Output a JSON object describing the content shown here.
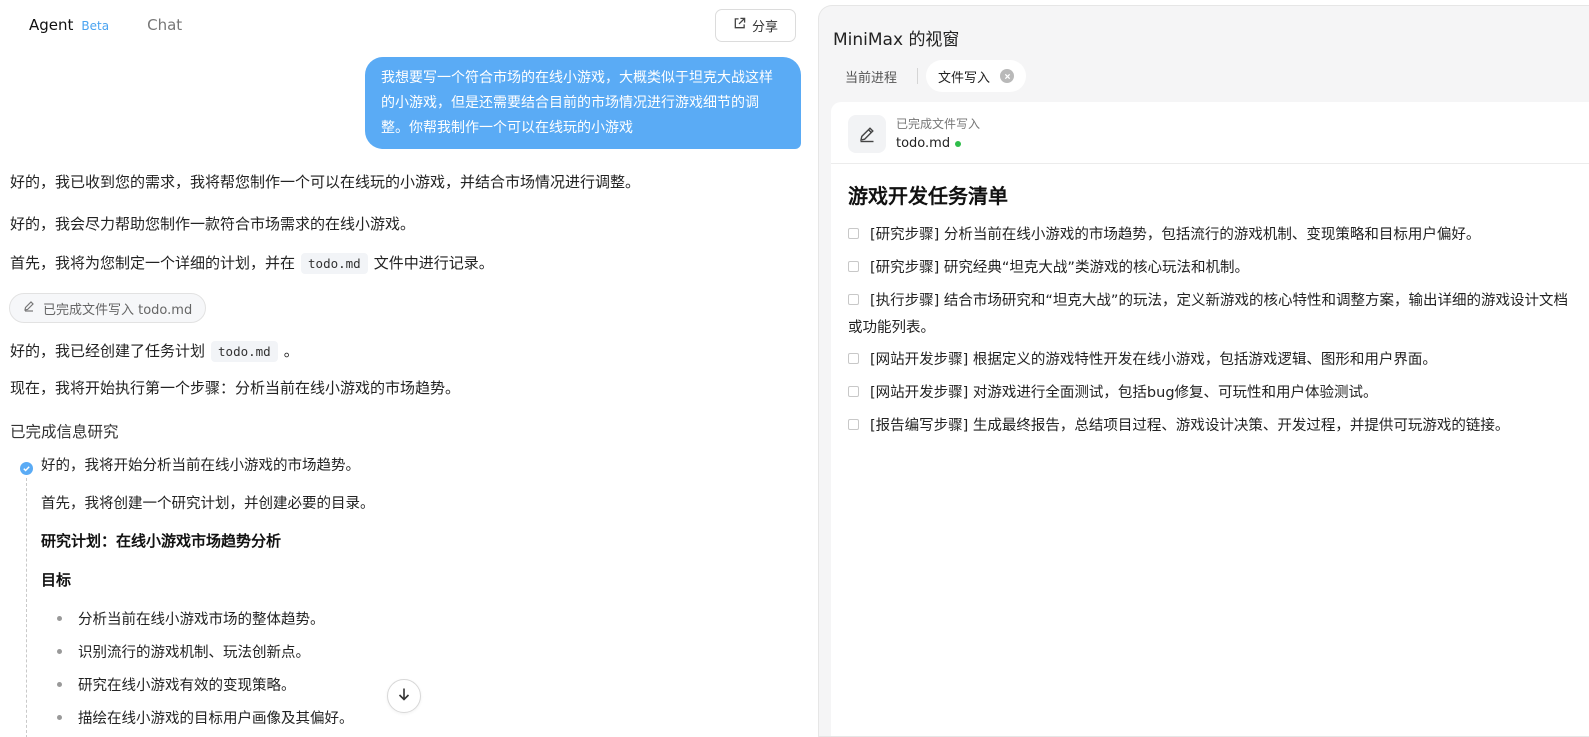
{
  "header": {
    "tab_agent": "Agent",
    "tab_beta": "Beta",
    "tab_chat": "Chat",
    "share_label": "分享"
  },
  "chat": {
    "user_message": "我想要写一个符合市场的在线小游戏，大概类似于坦克大战这样的小游戏，但是还需要结合目前的市场情况进行游戏细节的调整。你帮我制作一个可以在线玩的小游戏",
    "reply_1": "好的，我已收到您的需求，我将帮您制作一个可以在线玩的小游戏，并结合市场情况进行调整。",
    "reply_2": "好的，我会尽力帮助您制作一款符合市场需求的在线小游戏。",
    "reply_3_before": "首先，我将为您制定一个详细的计划，并在",
    "reply_3_code": "todo.md",
    "reply_3_after": "文件中进行记录。",
    "file_chip": "已完成文件写入 todo.md",
    "reply_4_before": "好的，我已经创建了任务计划",
    "reply_4_code": "todo.md",
    "reply_4_after": "。",
    "reply_5": "现在，我将开始执行第一个步骤：分析当前在线小游戏的市场趋势。",
    "research_title": "已完成信息研究",
    "timeline": {
      "step_1": "好的，我将开始分析当前在线小游戏的市场趋势。",
      "step_2": "首先，我将创建一个研究计划，并创建必要的目录。",
      "plan_heading": "研究计划：在线小游戏市场趋势分析",
      "goal_heading": "目标",
      "goals": [
        "分析当前在线小游戏市场的整体趋势。",
        "识别流行的游戏机制、玩法创新点。",
        "研究在线小游戏有效的变现策略。",
        "描绘在线小游戏的目标用户画像及其偏好。"
      ]
    }
  },
  "window": {
    "title": "MiniMax 的视窗",
    "tab_current": "当前进程",
    "tab_file": "文件写入",
    "file_status": "已完成文件写入",
    "file_name": "todo.md",
    "doc_title": "游戏开发任务清单",
    "tasks": [
      "[研究步骤] 分析当前在线小游戏的市场趋势，包括流行的游戏机制、变现策略和目标用户偏好。",
      "[研究步骤] 研究经典“坦克大战”类游戏的核心玩法和机制。",
      "[执行步骤] 结合市场研究和“坦克大战”的玩法，定义新游戏的核心特性和调整方案，输出详细的游戏设计文档或功能列表。",
      "[网站开发步骤] 根据定义的游戏特性开发在线小游戏，包括游戏逻辑、图形和用户界面。",
      "[网站开发步骤] 对游戏进行全面测试，包括bug修复、可玩性和用户体验测试。",
      "[报告编写步骤] 生成最终报告，总结项目过程、游戏设计决策、开发过程，并提供可玩游戏的链接。"
    ]
  },
  "colors": {
    "accent": "#5aabf5",
    "status_green": "#2ebd4a"
  }
}
